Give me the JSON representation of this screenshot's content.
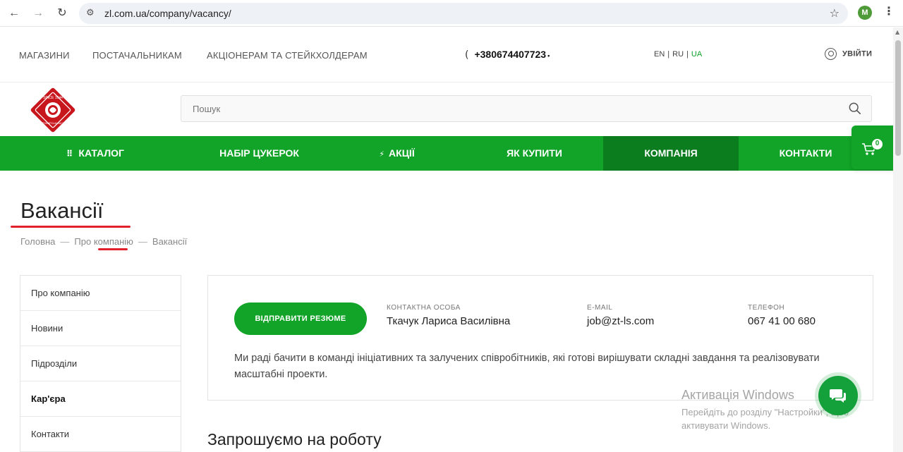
{
  "browser": {
    "url": "zl.com.ua/company/vacancy/",
    "profile_initial": "M",
    "back_glyph": "←",
    "forward_glyph": "→",
    "reload_glyph": "↻",
    "tune_glyph": "⚙",
    "star_glyph": "☆",
    "menu_glyph": "⋮"
  },
  "topbar": {
    "links": [
      "МАГАЗИНИ",
      "ПОСТАЧАЛЬНИКАМ",
      "АКЦІОНЕРАМ ТА СТЕЙКХОЛДЕРАМ"
    ],
    "phone": "+380674407723",
    "phone_caret": "•",
    "phone_icon_glyph": "(",
    "langs": [
      "EN",
      "RU",
      "UA"
    ],
    "lang_sep": "|",
    "active_lang": "UA",
    "login": "УВІЙТИ"
  },
  "search": {
    "placeholder": "Пошук"
  },
  "mainnav": {
    "items": [
      {
        "label": "КАТАЛОГ",
        "icon": "grid-icon",
        "glyph": "⠿"
      },
      {
        "label": "НАБІР ЦУКЕРОК"
      },
      {
        "label": "АКЦІЇ",
        "icon": "lightning-icon",
        "glyph": "⚡"
      },
      {
        "label": "ЯК КУПИТИ"
      },
      {
        "label": "КОМПАНІЯ",
        "active": true
      },
      {
        "label": "КОНТАКТИ"
      }
    ]
  },
  "cart": {
    "count": "0"
  },
  "page": {
    "title": "Вакансії",
    "breadcrumb": [
      "Головна",
      "Про компанію",
      "Вакансії"
    ],
    "breadcrumb_sep": "—"
  },
  "sidebar": {
    "items": [
      {
        "label": "Про компанію"
      },
      {
        "label": "Новини"
      },
      {
        "label": "Підрозділи"
      },
      {
        "label": "Кар'єра",
        "active": true
      },
      {
        "label": "Контакти"
      }
    ]
  },
  "contact": {
    "button": "ВІДПРАВИТИ РЕЗЮМЕ",
    "person_label": "КОНТАКТНА ОСОБА",
    "person": "Ткачук Лариса Василівна",
    "email_label": "E-MAIL",
    "email": "job@zt-ls.com",
    "phone_label": "ТЕЛЕФОН",
    "phone": "067 41 00 680",
    "intro": "Ми раді бачити в команді ініціативних та залучених співробітників, які готові вирішувати складні завдання та реалізовувати масштабні проекти."
  },
  "section_title": "Запрошуємо на роботу",
  "watermark": {
    "line1": "Активація Windows",
    "line2": "Перейдіть до розділу \"Настройки\", щоб",
    "line3": "активувати Windows."
  },
  "colors": {
    "brand_green": "#11a428",
    "active_green": "#0b7d1e",
    "accent_red": "#e0202a",
    "logo_red": "#c8161d"
  },
  "logo": {
    "text_top": "SINCE 1944",
    "text_bottom": "ЖИТОМИРСЬКІ ЛАСОЩІ"
  }
}
